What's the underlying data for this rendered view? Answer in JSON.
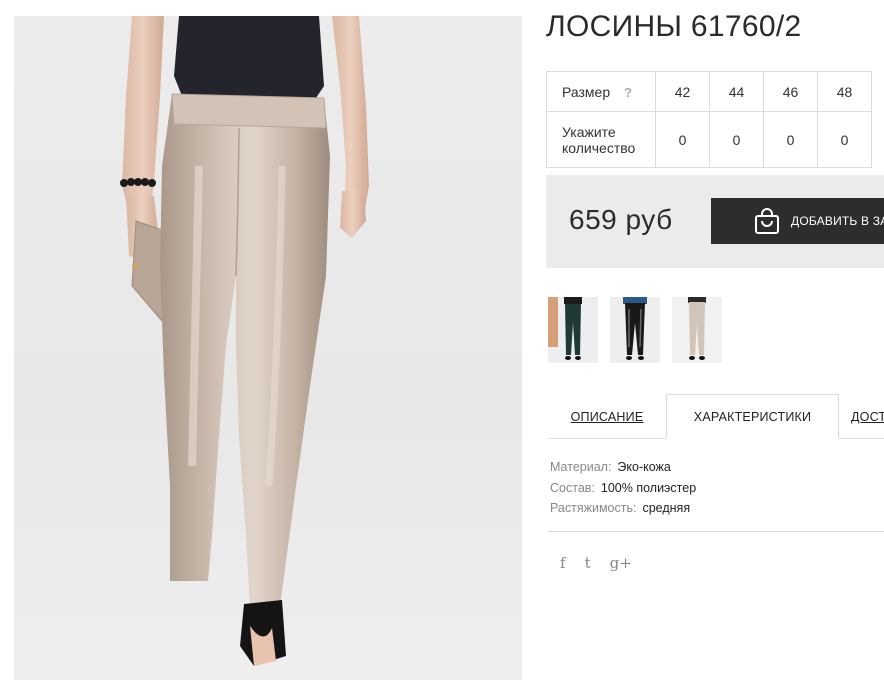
{
  "product": {
    "title": "ЛОСИНЫ 61760/2",
    "price": "659 руб",
    "add_to_cart_label": "ДОБАВИТЬ В ЗАКАЗ"
  },
  "size_table": {
    "size_label": "Размер",
    "help_mark": "?",
    "qty_label_line1": "Укажите",
    "qty_label_line2": "количество",
    "sizes": [
      "42",
      "44",
      "46",
      "48"
    ],
    "quantities": [
      "0",
      "0",
      "0",
      "0"
    ]
  },
  "tabs": {
    "description": "ОПИСАНИЕ",
    "characteristics": "ХАРАКТЕРИСТИКИ",
    "delivery": "ДОСТАВКА"
  },
  "specs": [
    {
      "key": "Материал:",
      "value": "Эко-кожа"
    },
    {
      "key": "Состав:",
      "value": "100% полиэстер"
    },
    {
      "key": "Растяжимость:",
      "value": "средняя"
    }
  ],
  "social": {
    "facebook": "f",
    "twitter": "t",
    "google_plus": "g+"
  },
  "icons": [
    "shopping-bag-icon",
    "facebook-icon",
    "twitter-icon",
    "google-plus-icon"
  ],
  "colors": {
    "button": "#2d2d2d",
    "price_bg": "#ebebeb",
    "border": "#dcdcdc",
    "product": "#c7b6a8"
  }
}
